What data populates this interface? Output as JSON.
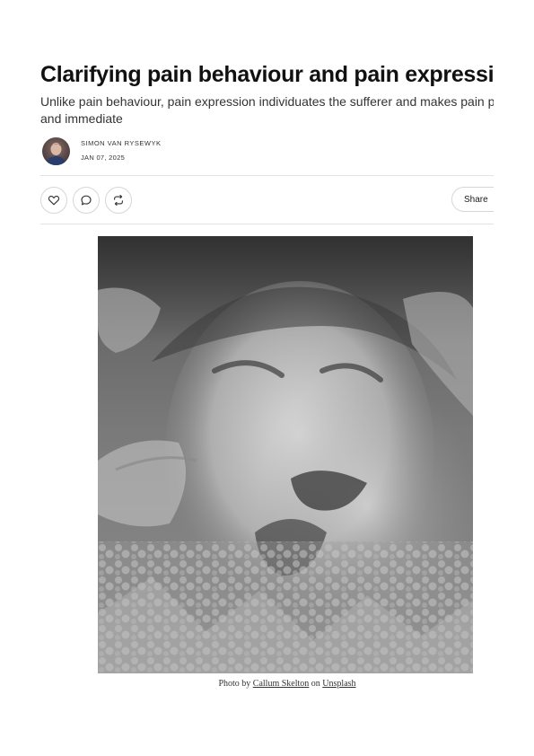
{
  "article": {
    "title": "Clarifying pain behaviour and pain expressio",
    "subtitle_line1": "Unlike pain behaviour, pain expression individuates the sufferer and makes pain perso",
    "subtitle_line2": "and immediate"
  },
  "byline": {
    "author": "SIMON VAN RYSEWYK",
    "date": "JAN 07, 2025",
    "avatar_icon": "author-avatar"
  },
  "actions": {
    "like_icon": "heart-icon",
    "comment_icon": "speech-bubble-icon",
    "restack_icon": "repost-arrows-icon",
    "share_label": "Share"
  },
  "image": {
    "description_icon": "photo",
    "tone": "grayscale"
  },
  "caption": {
    "prefix": "Photo by",
    "photographer": "Callum Skelton",
    "middle": "on",
    "source": "Unsplash"
  },
  "colors": {
    "text": "#1a1a1a",
    "rule": "#e3e3e3",
    "button_border": "#d6d6d6"
  }
}
